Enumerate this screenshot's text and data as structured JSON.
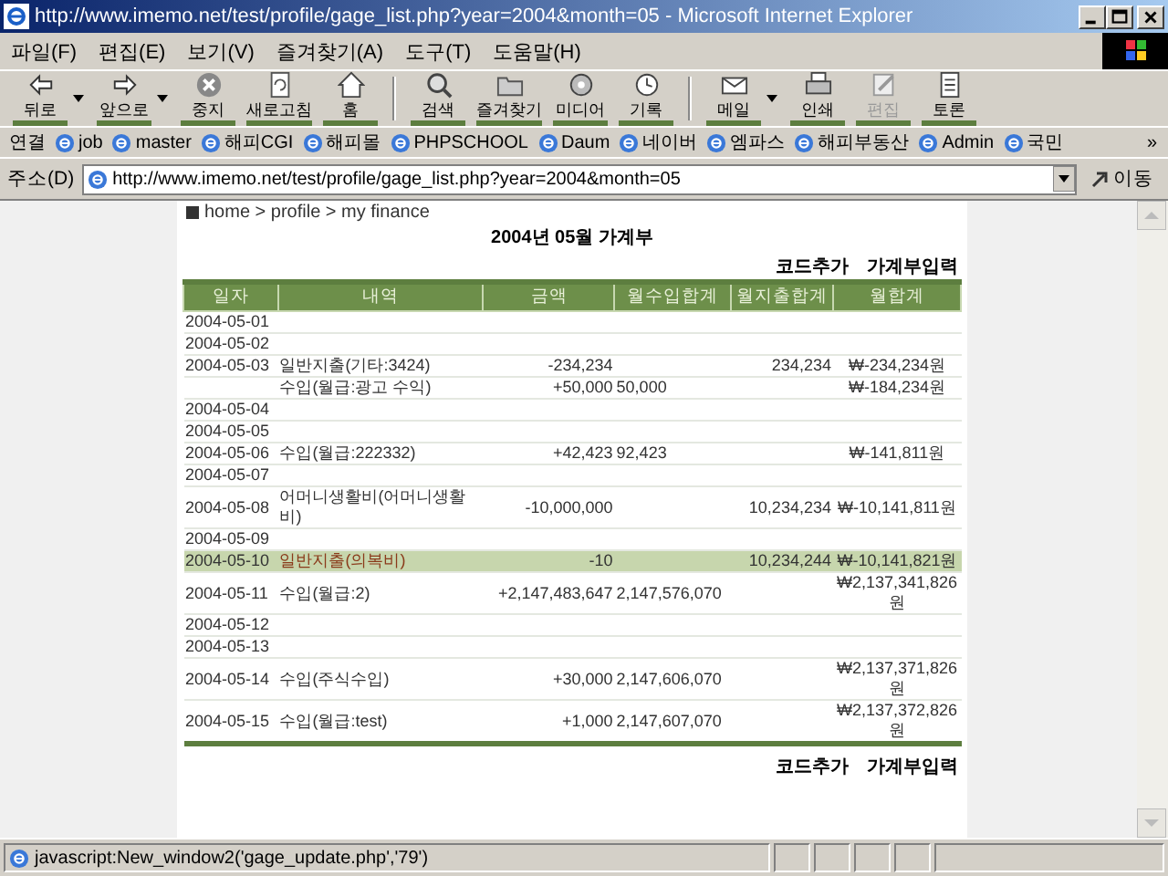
{
  "window": {
    "title": "http://www.imemo.net/test/profile/gage_list.php?year=2004&month=05 - Microsoft Internet Explorer"
  },
  "menu": [
    "파일(F)",
    "편집(E)",
    "보기(V)",
    "즐겨찾기(A)",
    "도구(T)",
    "도움말(H)"
  ],
  "toolbar": [
    {
      "label": "뒤로",
      "dropdown": true,
      "disabled": false
    },
    {
      "label": "앞으로",
      "dropdown": true,
      "disabled": false
    },
    {
      "label": "중지",
      "dropdown": false,
      "disabled": false
    },
    {
      "label": "새로고침",
      "dropdown": false,
      "disabled": false
    },
    {
      "label": "홈",
      "dropdown": false,
      "disabled": false
    },
    {
      "label": "검색",
      "dropdown": false,
      "disabled": false
    },
    {
      "label": "즐겨찾기",
      "dropdown": false,
      "disabled": false
    },
    {
      "label": "미디어",
      "dropdown": false,
      "disabled": false
    },
    {
      "label": "기록",
      "dropdown": false,
      "disabled": false
    },
    {
      "label": "메일",
      "dropdown": true,
      "disabled": false
    },
    {
      "label": "인쇄",
      "dropdown": false,
      "disabled": false
    },
    {
      "label": "편집",
      "dropdown": false,
      "disabled": true
    },
    {
      "label": "토론",
      "dropdown": false,
      "disabled": false
    }
  ],
  "links_bar": {
    "label": "연결",
    "items": [
      "job",
      "master",
      "해피CGI",
      "해피몰",
      "PHPSCHOOL",
      "Daum",
      "네이버",
      "엠파스",
      "해피부동산",
      "Admin",
      "국민"
    ],
    "more": "»"
  },
  "address_bar": {
    "label": "주소(D)",
    "value": "http://www.imemo.net/test/profile/gage_list.php?year=2004&month=05",
    "go": "이동"
  },
  "page": {
    "breadcrumb": "home > profile > my finance",
    "title": "2004년 05월 가계부",
    "actions": [
      "코드추가",
      "가계부입력"
    ],
    "table": {
      "columns": [
        "일자",
        "내역",
        "금액",
        "월수입합계",
        "월지출합계",
        "월합계"
      ],
      "rows": [
        {
          "date": "2004-05-01",
          "item": "",
          "amount": "",
          "income_total": "",
          "expense_total": "",
          "month_total": "",
          "selected": false
        },
        {
          "date": "2004-05-02",
          "item": "",
          "amount": "",
          "income_total": "",
          "expense_total": "",
          "month_total": "",
          "selected": false
        },
        {
          "date": "2004-05-03",
          "item": "일반지출(기타:3424)",
          "amount": "-234,234",
          "income_total": "",
          "expense_total": "234,234",
          "month_total": "₩-234,234원",
          "selected": false
        },
        {
          "date": "",
          "item": "수입(월급:광고 수익)",
          "amount": "+50,000",
          "income_total": "50,000",
          "expense_total": "",
          "month_total": "₩-184,234원",
          "selected": false
        },
        {
          "date": "2004-05-04",
          "item": "",
          "amount": "",
          "income_total": "",
          "expense_total": "",
          "month_total": "",
          "selected": false
        },
        {
          "date": "2004-05-05",
          "item": "",
          "amount": "",
          "income_total": "",
          "expense_total": "",
          "month_total": "",
          "selected": false
        },
        {
          "date": "2004-05-06",
          "item": "수입(월급:222332)",
          "amount": "+42,423",
          "income_total": "92,423",
          "expense_total": "",
          "month_total": "₩-141,811원",
          "selected": false
        },
        {
          "date": "2004-05-07",
          "item": "",
          "amount": "",
          "income_total": "",
          "expense_total": "",
          "month_total": "",
          "selected": false
        },
        {
          "date": "2004-05-08",
          "item": "어머니생활비(어머니생활비)",
          "amount": "-10,000,000",
          "income_total": "",
          "expense_total": "10,234,234",
          "month_total": "₩-10,141,811원",
          "selected": false
        },
        {
          "date": "2004-05-09",
          "item": "",
          "amount": "",
          "income_total": "",
          "expense_total": "",
          "month_total": "",
          "selected": false
        },
        {
          "date": "2004-05-10",
          "item": "일반지출(의복비)",
          "amount": "-10",
          "income_total": "",
          "expense_total": "10,234,244",
          "month_total": "₩-10,141,821원",
          "selected": true
        },
        {
          "date": "2004-05-11",
          "item": "수입(월급:2)",
          "amount": "+2,147,483,647",
          "income_total": "2,147,576,070",
          "expense_total": "",
          "month_total": "₩2,137,341,826원",
          "selected": false
        },
        {
          "date": "2004-05-12",
          "item": "",
          "amount": "",
          "income_total": "",
          "expense_total": "",
          "month_total": "",
          "selected": false
        },
        {
          "date": "2004-05-13",
          "item": "",
          "amount": "",
          "income_total": "",
          "expense_total": "",
          "month_total": "",
          "selected": false
        },
        {
          "date": "2004-05-14",
          "item": "수입(주식수입)",
          "amount": "+30,000",
          "income_total": "2,147,606,070",
          "expense_total": "",
          "month_total": "₩2,137,371,826원",
          "selected": false
        },
        {
          "date": "2004-05-15",
          "item": "수입(월급:test)",
          "amount": "+1,000",
          "income_total": "2,147,607,070",
          "expense_total": "",
          "month_total": "₩2,137,372,826원",
          "selected": false
        }
      ]
    },
    "footer_actions": [
      "코드추가",
      "가계부입력"
    ]
  },
  "status_bar": {
    "text": "javascript:New_window2('gage_update.php','79')"
  }
}
